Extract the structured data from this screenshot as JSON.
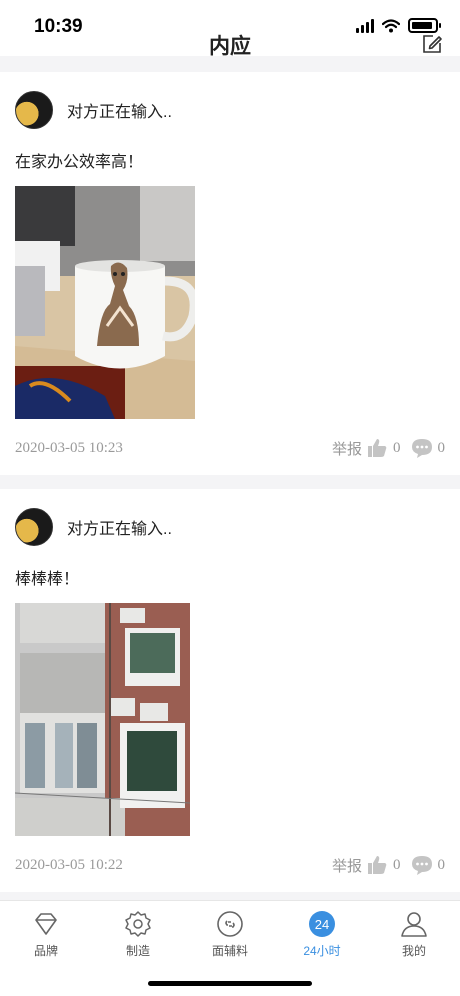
{
  "status": {
    "time": "10:39"
  },
  "nav": {
    "title": "内应"
  },
  "posts": [
    {
      "user": "对方正在输入..",
      "text": "在家办公效率高！",
      "photo": "giraffe-mug-photo",
      "time": "2020-03-05 10:23",
      "report": "举报",
      "likes": "0",
      "comments": "0"
    },
    {
      "user": "对方正在输入..",
      "text": "棒棒棒！",
      "photo": "building-photo",
      "time": "2020-03-05 10:22",
      "report": "举报",
      "likes": "0",
      "comments": "0"
    }
  ],
  "tabs": [
    {
      "label": "品牌",
      "icon": "diamond-icon"
    },
    {
      "label": "制造",
      "icon": "gear-icon"
    },
    {
      "label": "面辅料",
      "icon": "link-circle-icon"
    },
    {
      "label": "24小时",
      "icon": "24-badge-icon",
      "badge": "24",
      "active": true
    },
    {
      "label": "我的",
      "icon": "person-icon"
    }
  ],
  "colors": {
    "accent": "#3a8fe0",
    "meta": "#9a9a9a",
    "background": "#f4f4f6"
  }
}
